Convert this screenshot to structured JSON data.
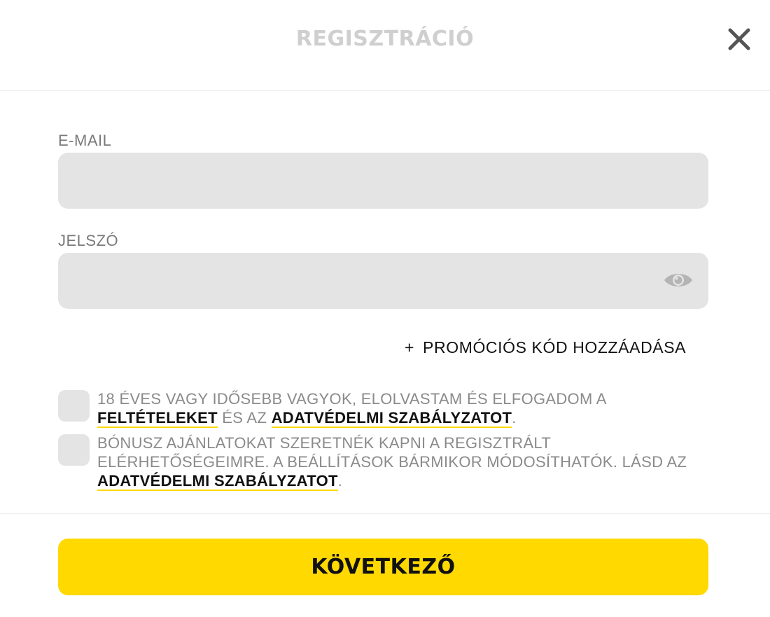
{
  "header": {
    "title": "REGISZTRÁCIÓ",
    "close_icon": "close-icon"
  },
  "form": {
    "email": {
      "label": "E-MAIL",
      "value": "",
      "placeholder": ""
    },
    "password": {
      "label": "JELSZÓ",
      "value": "",
      "placeholder": "",
      "toggle_icon": "eye-icon"
    },
    "promo": {
      "plus": "+",
      "label": "PROMÓCIÓS KÓD HOZZÁADÁSA"
    }
  },
  "consents": {
    "age": {
      "text_before": "18 ÉVES VAGY IDŐSEBB VAGYOK, ELOLVASTAM ÉS ELFOGADOM A",
      "link_terms": "FELTÉTELEKET",
      "text_middle": "ÉS AZ",
      "link_privacy": "ADATVÉDELMI SZABÁLYZATOT",
      "text_after": ".",
      "checked": false
    },
    "bonus": {
      "text_before": "BÓNUSZ AJÁNLATOKAT SZERETNÉK KAPNI A REGISZTRÁLT ELÉRHETŐSÉGEIMRE. A BEÁLLÍTÁSOK BÁRMIKOR MÓDOSÍTHATÓK. LÁSD AZ",
      "link_privacy": "ADATVÉDELMI SZABÁLYZATOT",
      "text_after": ".",
      "checked": false
    }
  },
  "footer": {
    "next_label": "KÖVETKEZŐ"
  },
  "colors": {
    "accent": "#ffd900",
    "field_background": "#e4e4e4",
    "title": "#cfcfcf"
  }
}
